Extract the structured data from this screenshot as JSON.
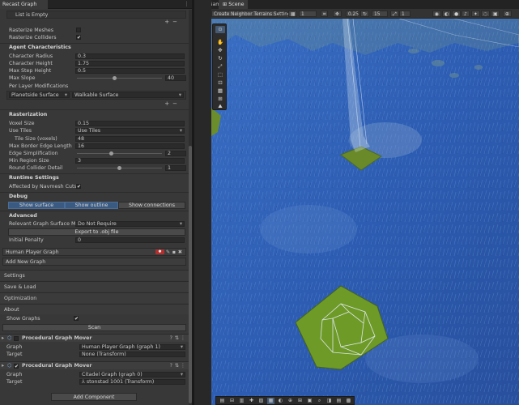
{
  "editor": {
    "inspector_tab": "Recast Graph",
    "game_tab": "Game",
    "scene_tab": "Scene"
  },
  "inspector": {
    "list_empty": "List is Empty",
    "rasterize_meshes": {
      "label": "Rasterize Meshes",
      "checked": false
    },
    "rasterize_colliders": {
      "label": "Rasterize Colliders",
      "checked": true
    },
    "agent_header": "Agent Characteristics",
    "character_radius": {
      "label": "Character Radius",
      "value": "0.3"
    },
    "character_height": {
      "label": "Character Height",
      "value": "1.75"
    },
    "max_step_height": {
      "label": "Max Step Height",
      "value": "0.5"
    },
    "max_slope": {
      "label": "Max Slope",
      "value": "40",
      "fraction": 0.44
    },
    "per_layer_label": "Per Layer Modifications",
    "layer_name": "Planetside Surface",
    "layer_mode": "Walkable Surface",
    "rasterization_header": "Rasterization",
    "voxel_size": {
      "label": "Voxel Size",
      "value": "0.15"
    },
    "use_tiles": {
      "label": "Use Tiles",
      "value": "Use Tiles"
    },
    "tile_size": {
      "label": "Tile Size (voxels)",
      "value": "48"
    },
    "max_border_edge": {
      "label": "Max Border Edge Length",
      "value": "16"
    },
    "edge_simplification": {
      "label": "Edge Simplification",
      "value": "2",
      "fraction": 0.4
    },
    "min_region_size": {
      "label": "Min Region Size",
      "value": "3"
    },
    "round_collider_detail": {
      "label": "Round Collider Detail",
      "value": "1",
      "fraction": 0.5
    },
    "runtime_header": "Runtime Settings",
    "affected_by_cuts": {
      "label": "Affected by Navmesh Cuts",
      "checked": true
    },
    "debug_header": "Debug",
    "debug_buttons": [
      "Show surface",
      "Show outline",
      "Show connections"
    ],
    "advanced_header": "Advanced",
    "relevant_mode": {
      "label": "Relevant Graph Surface Mode",
      "value": "Do Not Require"
    },
    "export_button": "Export to .obj file",
    "initial_penalty": {
      "label": "Initial Penalty",
      "value": "0"
    },
    "human_graph": "Human Player Graph",
    "add_new_graph": "Add New Graph",
    "sections": [
      "Settings",
      "Save & Load",
      "Optimization",
      "About"
    ],
    "show_graphs": {
      "label": "Show Graphs",
      "checked": true
    },
    "scan_button": "Scan",
    "mover1": {
      "title": "Procedural Graph Mover",
      "enabled": false,
      "graph_label": "Graph",
      "graph_value": "Human Player Graph (graph 1)",
      "target_label": "Target",
      "target_value": "None (Transform)"
    },
    "mover2": {
      "title": "Procedural Graph Mover",
      "enabled": true,
      "graph_label": "Graph",
      "graph_value": "Citadel Graph (graph 0)",
      "target_label": "Target",
      "target_value": "stonstad 1001 (Transform)"
    },
    "add_component": "Add Component"
  },
  "scene_toolbar": {
    "neighbor_dropdown": "Create Neighbor Terrains Settings",
    "grid_value": "1",
    "snap_value": "0.25",
    "rotate_value": "15",
    "scale_value": "1"
  },
  "colors": {
    "accent": "#3a5a82",
    "terrain_blue": "#2f5fb5",
    "terrain_green": "#6a8a2a"
  }
}
